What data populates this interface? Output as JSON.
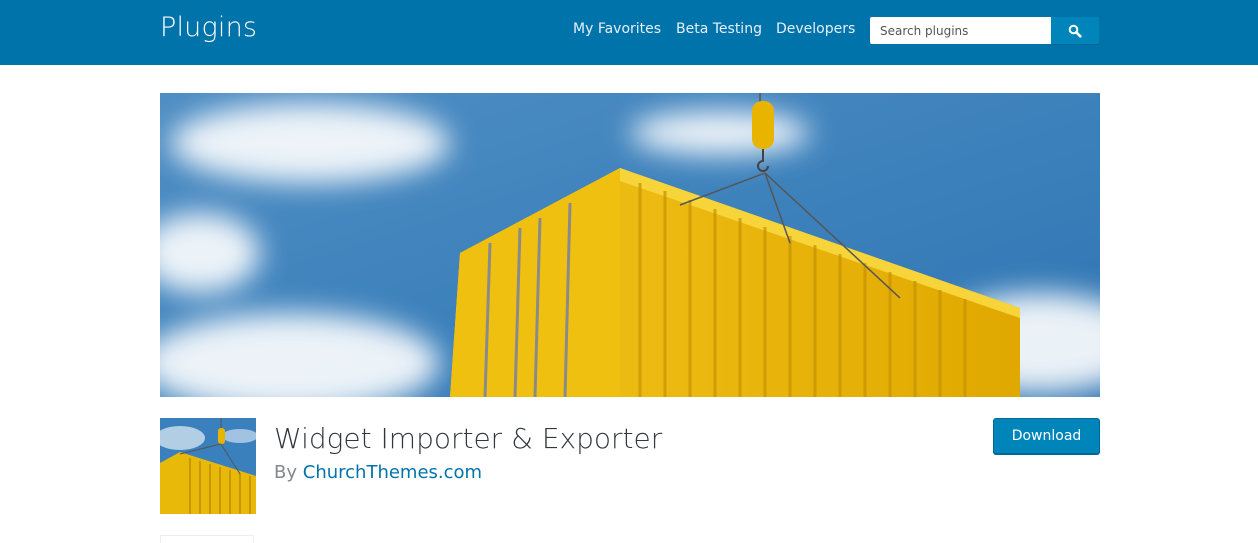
{
  "header": {
    "site_title": "Plugins",
    "nav": [
      "My Favorites",
      "Beta Testing",
      "Developers"
    ],
    "search": {
      "placeholder": "Search plugins",
      "value": "",
      "button_icon": "search-icon"
    },
    "color": "#0073aa"
  },
  "plugin": {
    "banner_icon": "shipping-container-banner-image",
    "icon": "shipping-container-icon-image",
    "title": "Widget Importer & Exporter",
    "by_label": "By",
    "author": "ChurchThemes.com",
    "download_label": "Download"
  },
  "colors": {
    "accent": "#0073aa",
    "button": "#0085ba",
    "title": "#32373c",
    "muted": "#82878c"
  }
}
